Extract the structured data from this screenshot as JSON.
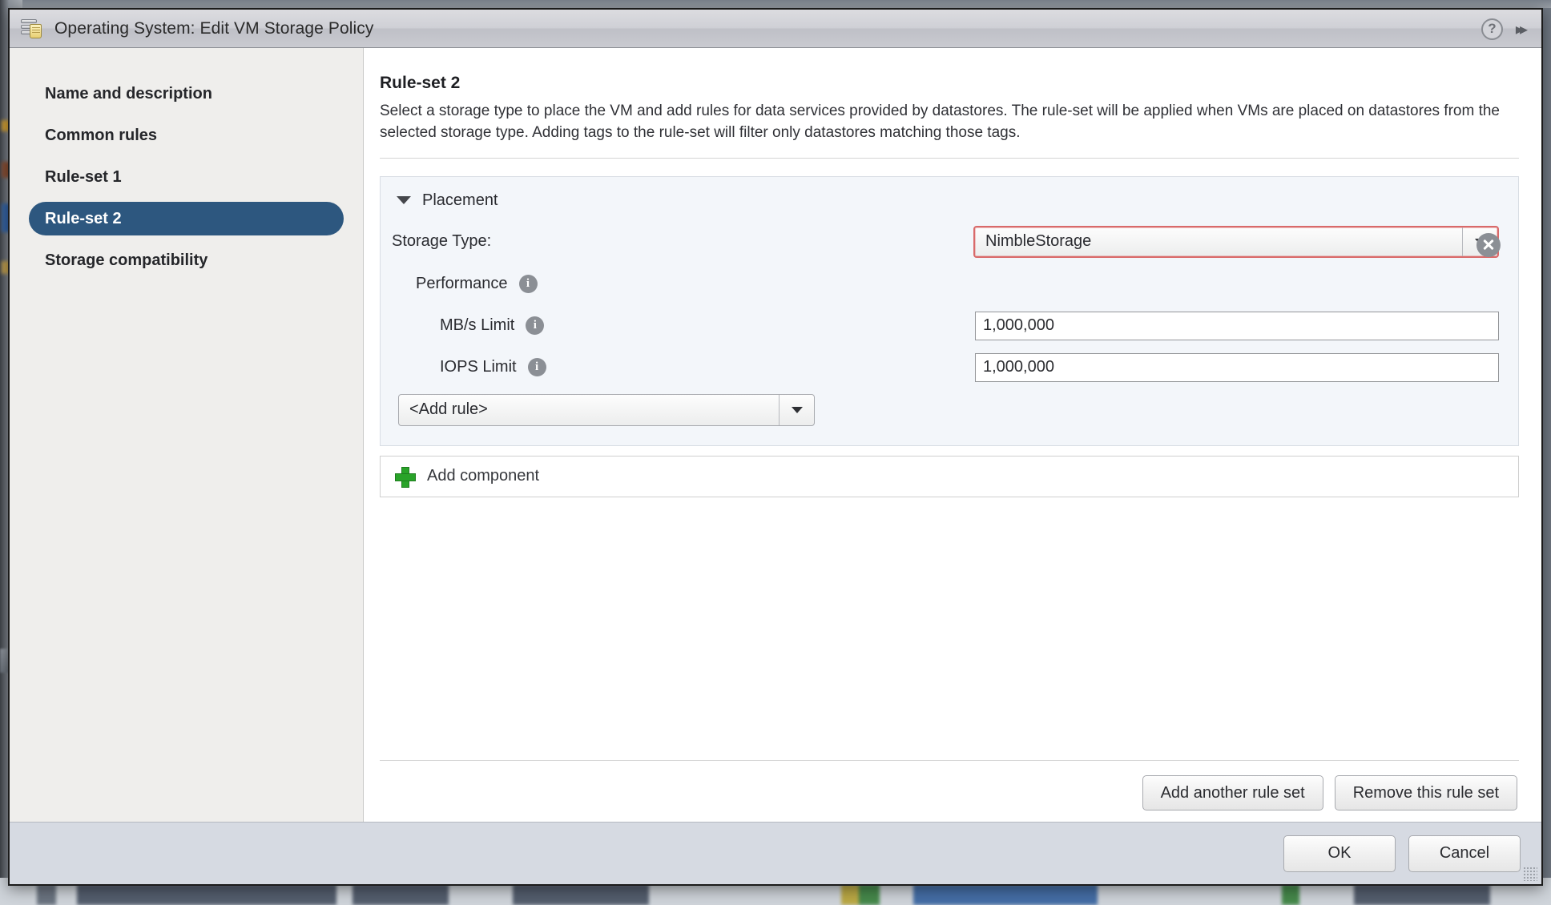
{
  "window": {
    "title": "Operating System: Edit VM Storage Policy",
    "icon": "storage-policy-icon",
    "help_icon": "?",
    "collapse_icon": "▸▸"
  },
  "sidebar": {
    "items": [
      {
        "label": "Name and description",
        "selected": false
      },
      {
        "label": "Common rules",
        "selected": false
      },
      {
        "label": "Rule-set 1",
        "selected": false
      },
      {
        "label": "Rule-set 2",
        "selected": true
      },
      {
        "label": "Storage compatibility",
        "selected": false
      }
    ]
  },
  "main": {
    "title": "Rule-set 2",
    "description": "Select a storage type to place the VM and add rules for data services provided by datastores. The rule-set will be applied when VMs are placed on datastores from the selected storage type. Adding tags to the rule-set will filter only datastores matching those tags.",
    "placement": {
      "section_label": "Placement",
      "expanded": true,
      "storage_type": {
        "label": "Storage Type:",
        "value": "NimbleStorage",
        "invalid": true,
        "invalid_border_color": "#d96a6a"
      },
      "component": {
        "name": "Performance",
        "info_tooltip_icon": "info-icon",
        "remove_icon": "remove-circle-icon",
        "rules": [
          {
            "label": "MB/s Limit",
            "value": "1,000,000"
          },
          {
            "label": "IOPS Limit",
            "value": "1,000,000"
          }
        ]
      },
      "add_rule": {
        "value": "<Add rule>"
      }
    },
    "add_component": {
      "label": "Add component",
      "icon": "plus-icon",
      "icon_color": "#29a329"
    },
    "ruleset_actions": [
      {
        "label": "Add another rule set"
      },
      {
        "label": "Remove this rule set"
      }
    ]
  },
  "footer": {
    "buttons": [
      {
        "label": "OK"
      },
      {
        "label": "Cancel"
      }
    ]
  },
  "colors": {
    "selected_nav": "#2d577f",
    "sidebar_bg": "#efeeec",
    "panel_bg": "#f3f6fa",
    "footer_bg": "#d6dae2"
  }
}
